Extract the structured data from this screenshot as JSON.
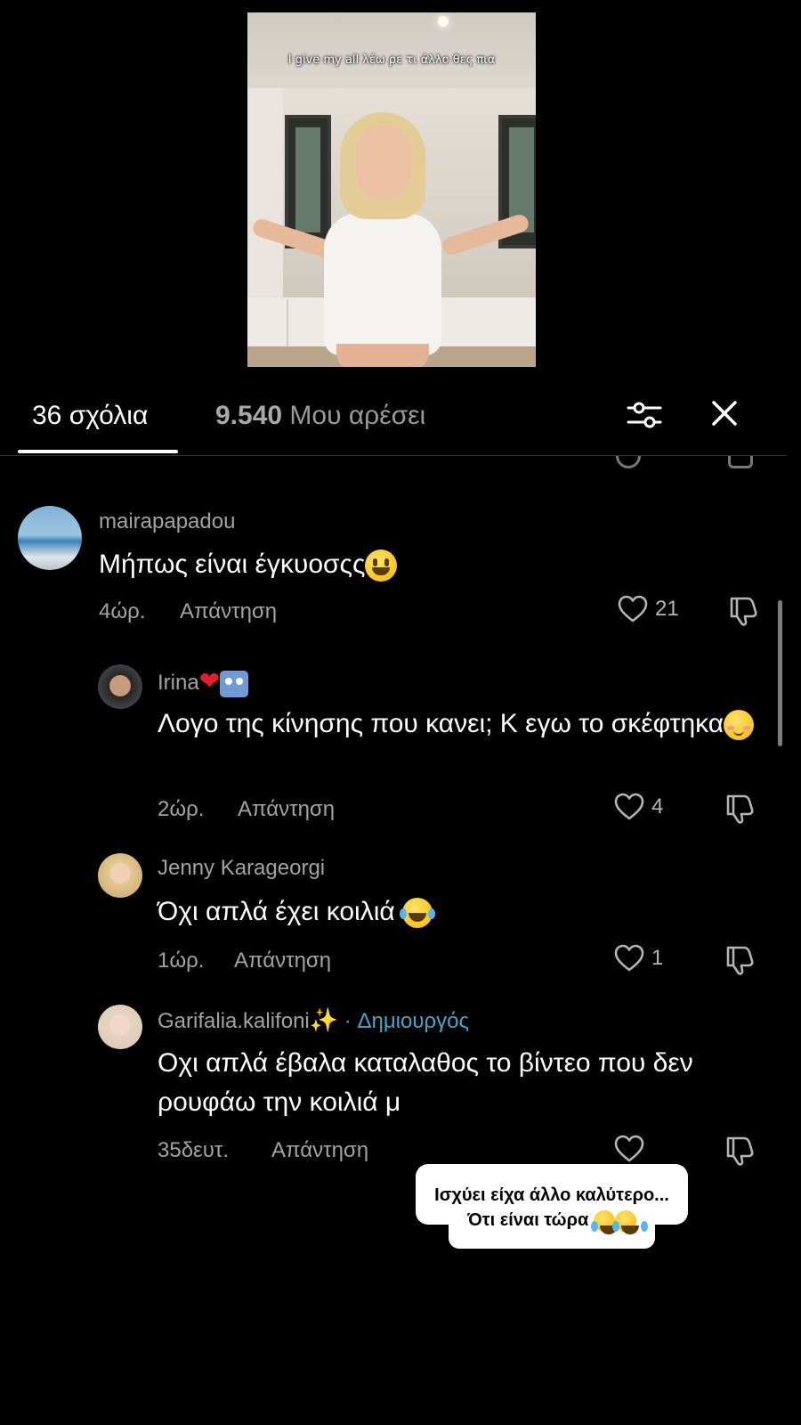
{
  "video": {
    "caption": "I give my all λέω ρε τι άλλο θες πια"
  },
  "header": {
    "comments_count": "36",
    "comments_label": "σχόλια",
    "likes_count": "9.540",
    "likes_label": "Μου αρέσει"
  },
  "comments": [
    {
      "username": "mairapapadou",
      "text": "Μήπως είναι έγκυοσςς",
      "time": "4ώρ.",
      "reply_label": "Απάντηση",
      "likes": "21"
    },
    {
      "username": "Irina",
      "text": "Λογο της κίνησης που κανει; Κ εγω το σκέφτηκα",
      "time": "2ώρ.",
      "reply_label": "Απάντηση",
      "likes": "4"
    },
    {
      "username": "Jenny Karageorgi",
      "text": "Όχι απλά έχει κοιλιά",
      "time": "1ώρ.",
      "reply_label": "Απάντηση",
      "likes": "1"
    },
    {
      "username": "Garifalia.kalifoni",
      "creator_badge": "· Δημιουργός",
      "text": "Οχι απλά έβαλα καταλαθος το βίντεο που δεν ρουφάω την κοιλιά μ",
      "time": "35δευτ.",
      "reply_label": "Απάντηση",
      "likes": ""
    }
  ],
  "sticker": {
    "line1": "Ισχύει είχα άλλο καλύτερο...",
    "line2": "Ότι είναι τώρα"
  },
  "colors": {
    "background": "#000000",
    "creator": "#4aa3c9",
    "secondary_text": "#a3a3a3"
  }
}
